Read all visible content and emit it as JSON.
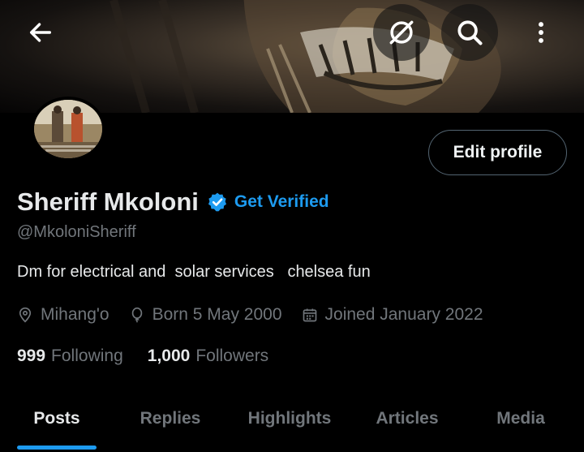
{
  "header": {
    "back_icon": "arrow-left-icon",
    "grok_icon": "grok-icon",
    "search_icon": "search-icon",
    "more_icon": "more-vertical-icon"
  },
  "profile": {
    "name": "Sheriff Mkoloni",
    "verified_badge_icon": "verified-badge-icon",
    "get_verified": "Get Verified",
    "handle": "@MkoloniSheriff",
    "bio": "Dm for electrical and  solar services   chelsea fun",
    "location": "Mihang'o",
    "born": "Born 5 May 2000",
    "joined": "Joined January 2022",
    "edit_profile": "Edit profile"
  },
  "stats": {
    "following_count": "999",
    "following_label": "Following",
    "followers_count": "1,000",
    "followers_label": "Followers"
  },
  "tabs": [
    {
      "label": "Posts",
      "active": true
    },
    {
      "label": "Replies"
    },
    {
      "label": "Highlights"
    },
    {
      "label": "Articles"
    },
    {
      "label": "Media"
    }
  ],
  "colors": {
    "accent": "#1d9bf0",
    "muted": "#71767b",
    "text": "#e7e9ea",
    "background": "#000000",
    "border": "#536471"
  }
}
